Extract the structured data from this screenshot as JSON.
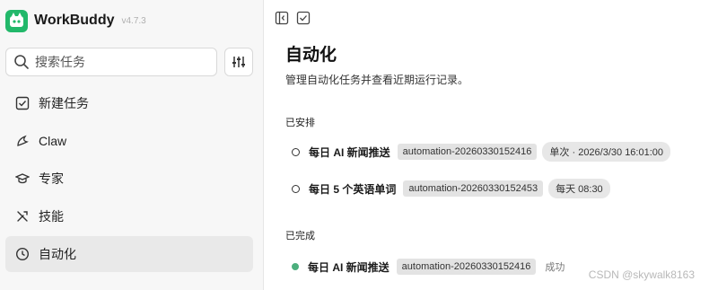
{
  "app": {
    "name": "WorkBuddy",
    "version": "v4.7.3",
    "brand_color": "#22b86a"
  },
  "search": {
    "placeholder": "搜索任务"
  },
  "sidebar": {
    "items": [
      {
        "label": "新建任务",
        "icon": "new-task-icon"
      },
      {
        "label": "Claw",
        "icon": "claw-icon"
      },
      {
        "label": "专家",
        "icon": "expert-icon"
      },
      {
        "label": "技能",
        "icon": "skills-icon"
      },
      {
        "label": "自动化",
        "icon": "clock-icon",
        "active": true
      }
    ]
  },
  "main": {
    "title": "自动化",
    "description": "管理自动化任务并查看近期运行记录。",
    "scheduled": {
      "label": "已安排",
      "tasks": [
        {
          "name": "每日 AI 新闻推送",
          "id": "automation-20260330152416",
          "schedule": "单次 · 2026/3/30 16:01:00"
        },
        {
          "name": "每日 5 个英语单词",
          "id": "automation-20260330152453",
          "schedule": "每天 08:30"
        }
      ]
    },
    "completed": {
      "label": "已完成",
      "tasks": [
        {
          "name": "每日 AI 新闻推送",
          "id": "automation-20260330152416",
          "status": "成功",
          "status_color": "#4caf7d"
        }
      ]
    }
  },
  "watermark": "CSDN @skywalk8163"
}
